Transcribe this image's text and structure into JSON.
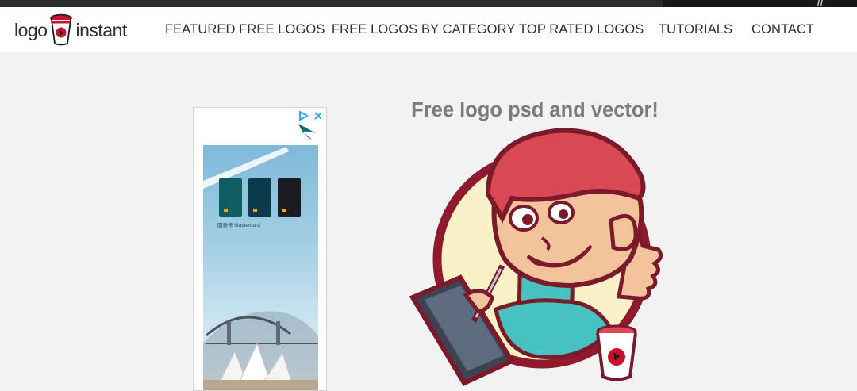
{
  "header": {
    "logo_left": "logo",
    "logo_right": "instant",
    "nav": [
      {
        "label": "FEATURED FREE LOGOS"
      },
      {
        "label": "FREE LOGOS BY CATEGORY"
      },
      {
        "label": "TOP RATED LOGOS"
      },
      {
        "label": "TUTORIALS"
      },
      {
        "label": "CONTACT"
      }
    ]
  },
  "ad": {
    "caption": "國泰卡 Mastercard"
  },
  "main": {
    "headline": "Free logo psd and vector!"
  },
  "colors": {
    "nav_text": "#2f2f2f",
    "headline": "#7b7b7b",
    "background": "#f2f2f2",
    "ad_choices": "#1aa3e8",
    "cathay_green": "#0d6b6e"
  },
  "icons": [
    "logo-cup-icon",
    "ad-choices-icon",
    "ad-close-icon",
    "cathay-brand-icon",
    "mascot-illustration"
  ]
}
